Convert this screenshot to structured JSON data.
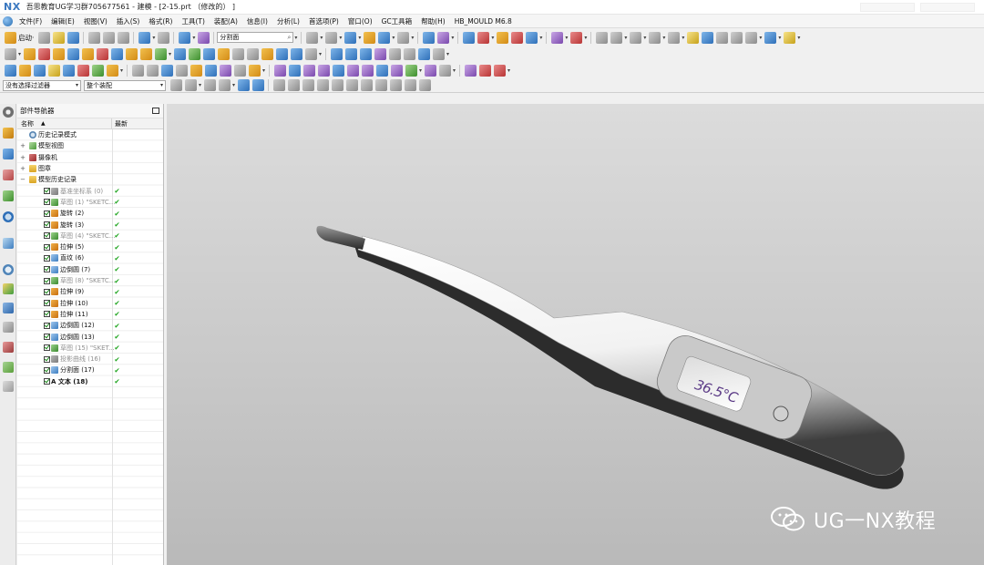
{
  "app": {
    "logo": "NX",
    "title": "吾思教育UG学习群705677561 - 建模 - [2-15.prt （修改的） ]"
  },
  "menu": {
    "items": [
      "文件(F)",
      "编辑(E)",
      "视图(V)",
      "插入(S)",
      "格式(R)",
      "工具(T)",
      "装配(A)",
      "信息(I)",
      "分析(L)",
      "首选项(P)",
      "窗口(O)",
      "GC工具箱",
      "帮助(H)",
      "HB_MOULD M6.8"
    ]
  },
  "toolbar": {
    "start_label": "启动·",
    "search_value": "分割面",
    "selection_filter": "没有选择过滤器",
    "assembly_scope": "整个装配"
  },
  "navigator": {
    "title": "部件导航器",
    "col_name": "名称",
    "col_sort_icon": "▲",
    "col_latest": "最新",
    "rows": [
      {
        "label": "历史记录模式",
        "check": false,
        "status": "",
        "grey": false,
        "bold": false,
        "icon": "clock",
        "expand": ""
      },
      {
        "label": "模型视图",
        "check": false,
        "status": "",
        "grey": false,
        "bold": false,
        "icon": "view",
        "expand": "+"
      },
      {
        "label": "摄像机",
        "check": false,
        "status": "",
        "grey": false,
        "bold": false,
        "icon": "cam",
        "expand": "+"
      },
      {
        "label": "图章",
        "check": false,
        "status": "",
        "grey": false,
        "bold": false,
        "icon": "folder",
        "expand": "+"
      },
      {
        "label": "模型历史记录",
        "check": false,
        "status": "",
        "grey": false,
        "bold": false,
        "icon": "folder",
        "expand": "−"
      },
      {
        "label": "基准坐标系 (0)",
        "check": true,
        "status": "✔",
        "grey": true,
        "bold": false,
        "icon": "datum",
        "expand": ""
      },
      {
        "label": "草图 (1) \"SKETC...",
        "check": true,
        "status": "✔",
        "grey": true,
        "bold": false,
        "icon": "sketch",
        "expand": ""
      },
      {
        "label": "旋转 (2)",
        "check": true,
        "status": "✔",
        "grey": false,
        "bold": false,
        "icon": "feat",
        "expand": ""
      },
      {
        "label": "旋转 (3)",
        "check": true,
        "status": "✔",
        "grey": false,
        "bold": false,
        "icon": "feat",
        "expand": ""
      },
      {
        "label": "草图 (4) \"SKETC...",
        "check": true,
        "status": "✔",
        "grey": true,
        "bold": false,
        "icon": "sketch",
        "expand": ""
      },
      {
        "label": "拉伸 (5)",
        "check": true,
        "status": "✔",
        "grey": false,
        "bold": false,
        "icon": "feat",
        "expand": ""
      },
      {
        "label": "直纹 (6)",
        "check": true,
        "status": "✔",
        "grey": false,
        "bold": false,
        "icon": "blend",
        "expand": ""
      },
      {
        "label": "边倒圆 (7)",
        "check": true,
        "status": "✔",
        "grey": false,
        "bold": false,
        "icon": "blend",
        "expand": ""
      },
      {
        "label": "草图 (8) \"SKETC...",
        "check": true,
        "status": "✔",
        "grey": true,
        "bold": false,
        "icon": "sketch",
        "expand": ""
      },
      {
        "label": "拉伸 (9)",
        "check": true,
        "status": "✔",
        "grey": false,
        "bold": false,
        "icon": "feat",
        "expand": ""
      },
      {
        "label": "拉伸 (10)",
        "check": true,
        "status": "✔",
        "grey": false,
        "bold": false,
        "icon": "feat",
        "expand": ""
      },
      {
        "label": "拉伸 (11)",
        "check": true,
        "status": "✔",
        "grey": false,
        "bold": false,
        "icon": "feat",
        "expand": ""
      },
      {
        "label": "边倒圆 (12)",
        "check": true,
        "status": "✔",
        "grey": false,
        "bold": false,
        "icon": "blend",
        "expand": ""
      },
      {
        "label": "边倒圆 (13)",
        "check": true,
        "status": "✔",
        "grey": false,
        "bold": false,
        "icon": "blend",
        "expand": ""
      },
      {
        "label": "草图 (15) \"SKET...",
        "check": true,
        "status": "✔",
        "grey": true,
        "bold": false,
        "icon": "sketch",
        "expand": ""
      },
      {
        "label": "投影曲线 (16)",
        "check": true,
        "status": "✔",
        "grey": true,
        "bold": false,
        "icon": "datum",
        "expand": ""
      },
      {
        "label": "分割面 (17)",
        "check": true,
        "status": "✔",
        "grey": false,
        "bold": false,
        "icon": "blend",
        "expand": ""
      },
      {
        "label": "A 文本 (18)",
        "check": true,
        "status": "✔",
        "grey": false,
        "bold": true,
        "icon": "none",
        "expand": ""
      }
    ]
  },
  "viewport": {
    "display_text": "36.5°C",
    "watermark": "UG一NX教程"
  },
  "colors": {
    "accent": "#3a78c0",
    "check_green": "#1aa31a",
    "lcd_text": "#5b3a86"
  }
}
